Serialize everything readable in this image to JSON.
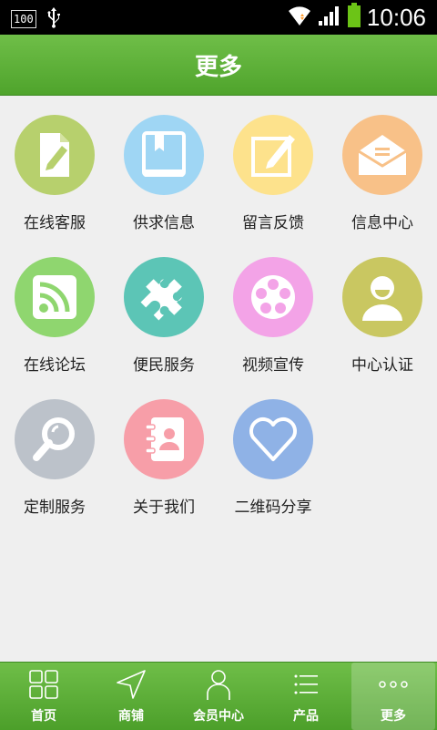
{
  "status_bar": {
    "battery_percent": "100",
    "time": "10:06"
  },
  "header": {
    "title": "更多"
  },
  "grid": [
    {
      "label": "在线客服",
      "icon": "edit-document-icon",
      "color": "#b7d06d"
    },
    {
      "label": "供求信息",
      "icon": "book-icon",
      "color": "#9fd6f4"
    },
    {
      "label": "留言反馈",
      "icon": "note-pen-icon",
      "color": "#fde28c"
    },
    {
      "label": "信息中心",
      "icon": "mail-icon",
      "color": "#f8c188"
    },
    {
      "label": "在线论坛",
      "icon": "rss-icon",
      "color": "#8fd66f"
    },
    {
      "label": "便民服务",
      "icon": "puzzle-icon",
      "color": "#5cc5b6"
    },
    {
      "label": "视频宣传",
      "icon": "film-reel-icon",
      "color": "#f3a3e7"
    },
    {
      "label": "中心认证",
      "icon": "user-icon",
      "color": "#c9c761"
    },
    {
      "label": "定制服务",
      "icon": "magnifier-icon",
      "color": "#bcc2ca"
    },
    {
      "label": "关于我们",
      "icon": "address-book-icon",
      "color": "#f79ea8"
    },
    {
      "label": "二维码分享",
      "icon": "heart-icon",
      "color": "#8fb2e6"
    }
  ],
  "bottom_nav": [
    {
      "label": "首页",
      "icon": "grid-icon",
      "active": false
    },
    {
      "label": "商铺",
      "icon": "navigation-arrow-icon",
      "active": false
    },
    {
      "label": "会员中心",
      "icon": "person-icon",
      "active": false
    },
    {
      "label": "产品",
      "icon": "list-icon",
      "active": false
    },
    {
      "label": "更多",
      "icon": "more-dots-icon",
      "active": true
    }
  ]
}
